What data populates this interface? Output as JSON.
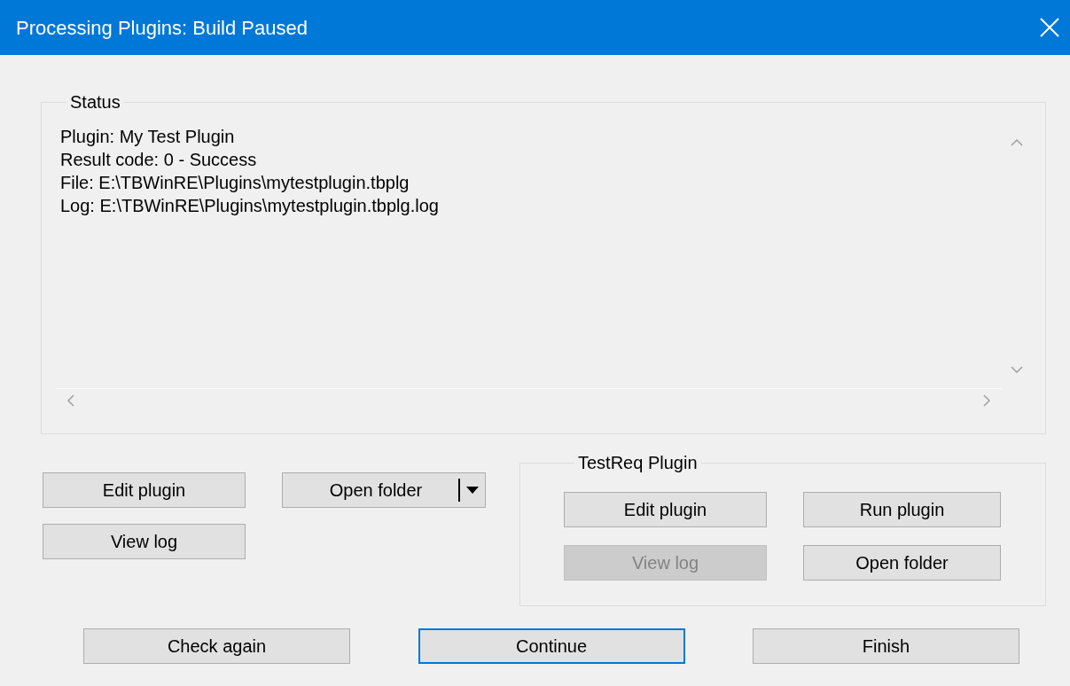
{
  "window": {
    "title": "Processing Plugins: Build Paused"
  },
  "status": {
    "label": "Status",
    "lines": [
      "Plugin: My Test Plugin",
      "Result code: 0 - Success",
      "File: E:\\TBWinRE\\Plugins\\mytestplugin.tbplg",
      "Log: E:\\TBWinRE\\Plugins\\mytestplugin.tbplg.log"
    ]
  },
  "left_buttons": [
    {
      "label": "Edit plugin",
      "kind": "button"
    },
    {
      "label": "Open folder",
      "kind": "split"
    },
    {
      "label": "View log",
      "kind": "button"
    }
  ],
  "group": {
    "label": "TestReq Plugin",
    "buttons": [
      {
        "label": "Edit plugin",
        "disabled": false
      },
      {
        "label": "Run plugin",
        "disabled": false
      },
      {
        "label": "View log",
        "disabled": true
      },
      {
        "label": "Open folder",
        "disabled": false
      }
    ]
  },
  "footer_buttons": [
    {
      "label": "Check again",
      "focused": false
    },
    {
      "label": "Continue",
      "focused": true
    },
    {
      "label": "Finish",
      "focused": false
    }
  ]
}
